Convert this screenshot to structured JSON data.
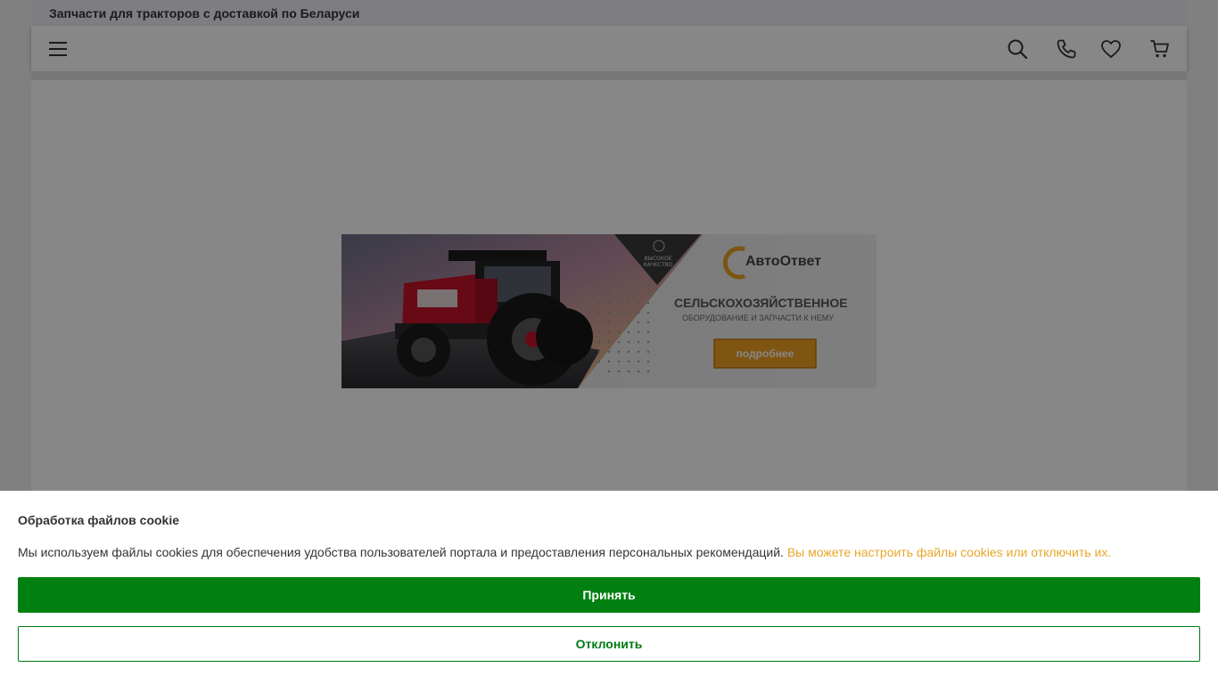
{
  "topbar": {
    "title": "Запчасти для тракторов с доставкой по Беларуси"
  },
  "header": {
    "icons": {
      "menu": "menu-icon",
      "search": "search-icon",
      "phone": "phone-icon",
      "favorites": "heart-icon",
      "cart": "cart-icon"
    }
  },
  "banner": {
    "badge_line1": "ВЫСОКОЕ",
    "badge_line2": "КАЧЕСТВО",
    "brand": "АвтоОтвет",
    "headline": "СЕЛЬСКОХОЗЯЙСТВЕННОЕ",
    "subheadline": "ОБОРУДОВАНИЕ И ЗАПЧАСТИ К НЕМУ",
    "button_label": "подробнее"
  },
  "cookie": {
    "title": "Обработка файлов cookie",
    "text": "Мы используем файлы cookies для обеспечения удобства пользователей портала и предоставления персональных рекомендаций.",
    "link_text": "Вы можете настроить файлы cookies или отключить их.",
    "accept_label": "Принять",
    "decline_label": "Отклонить"
  },
  "colors": {
    "accent_green": "#008010",
    "link_orange": "#e6a729",
    "banner_button": "#f0a020",
    "overlay": "rgba(0,0,0,0.47)"
  }
}
